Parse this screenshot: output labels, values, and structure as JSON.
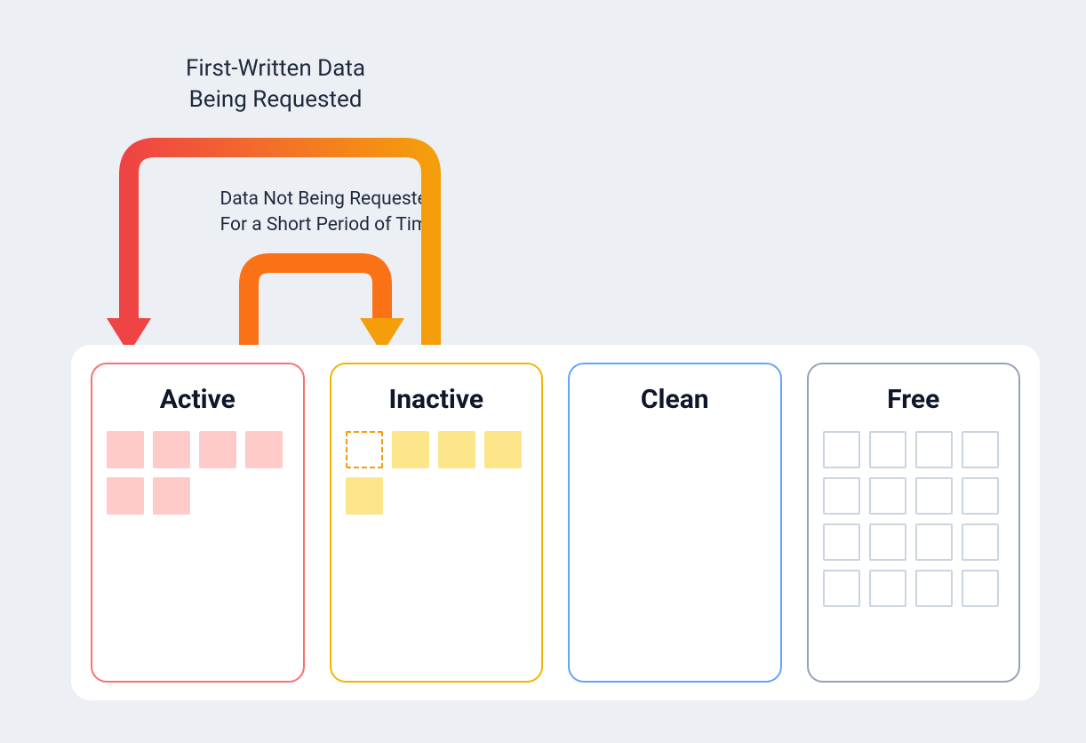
{
  "labels": {
    "first_written_line1": "First-Written Data",
    "first_written_line2": "Being Requested",
    "not_requested_line1": "Data Not Being Requested",
    "not_requested_line2": "For a Short Period of Time"
  },
  "buckets": {
    "active": {
      "title": "Active"
    },
    "inactive": {
      "title": "Inactive"
    },
    "clean": {
      "title": "Clean"
    },
    "free": {
      "title": "Free"
    }
  },
  "colors": {
    "bg": "#eceff4",
    "panel": "#ffffff",
    "text": "#1e293b",
    "active_border": "#f87171",
    "active_fill": "#fecaca",
    "inactive_border": "#f5b301",
    "inactive_fill": "#fde68a",
    "clean_border": "#60a5fa",
    "free_border": "#94a3b8",
    "free_cell": "#cbd5e1",
    "arrow_grad_start": "#ef4444",
    "arrow_grad_end": "#f59e0b",
    "arrow_inner": "#f97316"
  },
  "diagram": {
    "active_cells": 6,
    "inactive_cells": {
      "dashed": 1,
      "solid": 4
    },
    "clean_cells": 0,
    "free_cells": 16,
    "arrows": [
      {
        "from": "inactive",
        "to": "active",
        "label_ref": "first_written"
      },
      {
        "from": "active",
        "to": "inactive",
        "label_ref": "not_requested"
      }
    ]
  }
}
